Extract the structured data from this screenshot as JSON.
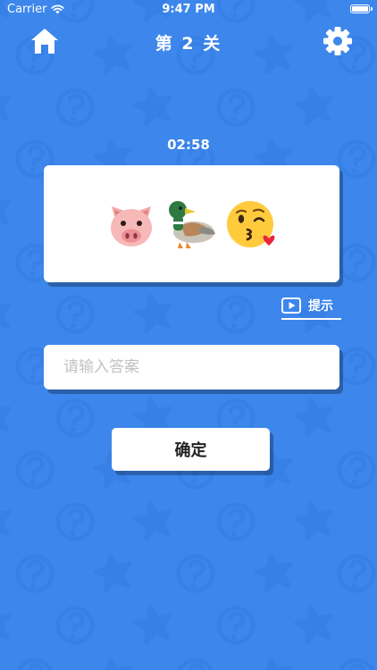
{
  "status_bar": {
    "carrier": "Carrier",
    "time": "9:47 PM",
    "wifi_icon": "wifi-icon",
    "battery_icon": "battery-icon"
  },
  "nav": {
    "title": "第 2 关",
    "home_icon": "home-icon",
    "settings_icon": "gear-icon"
  },
  "game": {
    "timer": "02:58",
    "emoji_puzzle": [
      "pig-face",
      "duck",
      "face-blowing-a-kiss"
    ],
    "hint_label": "提示",
    "hint_icon": "video-play-icon"
  },
  "answer": {
    "placeholder": "请输入答案",
    "value": ""
  },
  "confirm_button": {
    "label": "确定"
  },
  "colors": {
    "background": "#3c86ec",
    "card": "#ffffff",
    "pattern": "#2a6fd4"
  }
}
